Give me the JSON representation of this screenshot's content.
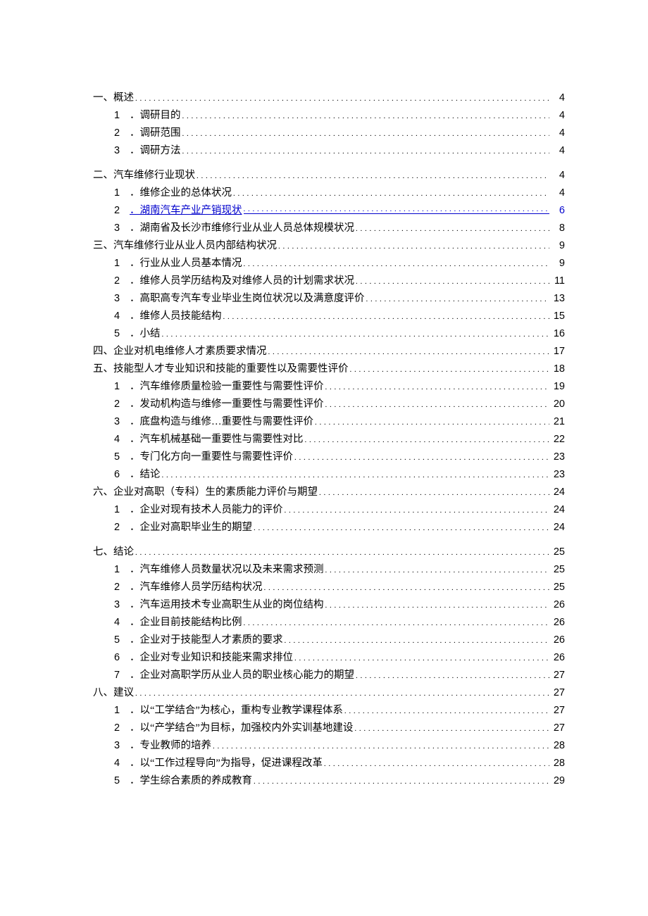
{
  "toc": [
    {
      "level": 1,
      "num": "一、",
      "title": "概述",
      "page": "4",
      "link": false
    },
    {
      "level": 2,
      "num": "1",
      "title": "．调研目的",
      "page": "4",
      "link": false
    },
    {
      "level": 2,
      "num": "2",
      "title": "．调研范围",
      "page": "4",
      "link": false
    },
    {
      "level": 2,
      "num": "3",
      "title": "．调研方法",
      "page": "4",
      "link": false
    },
    {
      "level": 0
    },
    {
      "level": 1,
      "num": "二、",
      "title": "汽车维修行业现状",
      "page": "4",
      "link": false
    },
    {
      "level": 2,
      "num": "1",
      "title": "．维修企业的总体状况",
      "page": "4",
      "link": false
    },
    {
      "level": 2,
      "num": "2",
      "title": "．湖南汽车产业产销现状",
      "page": "6",
      "link": true
    },
    {
      "level": 2,
      "num": "3",
      "title": "．湖南省及长沙市维修行业从业人员总体规模状况",
      "page": "8",
      "link": false
    },
    {
      "level": 1,
      "num": "三、",
      "title": "汽车维修行业从业人员内部结构状况",
      "page": "9",
      "link": false
    },
    {
      "level": 2,
      "num": "1",
      "title": "．行业从业人员基本情况",
      "page": "9",
      "link": false
    },
    {
      "level": 2,
      "num": "2",
      "title": "．维修人员学历结构及对维修人员的计划需求状况",
      "page": "11",
      "link": false
    },
    {
      "level": 2,
      "num": "3",
      "title": "．高职高专汽车专业毕业生岗位状况以及满意度评价",
      "page": "13",
      "link": false
    },
    {
      "level": 2,
      "num": "4",
      "title": "．维修人员技能结构",
      "page": "15",
      "link": false
    },
    {
      "level": 2,
      "num": "5",
      "title": "．小结",
      "page": "16",
      "link": false
    },
    {
      "level": 1,
      "num": "四、",
      "title": "企业对机电维修人才素质要求情况",
      "page": "17",
      "link": false
    },
    {
      "level": 1,
      "num": "五、",
      "title": "技能型人才专业知识和技能的重要性以及需要性评价",
      "page": "18",
      "link": false
    },
    {
      "level": 2,
      "num": "1",
      "title": "．汽车维修质量检验一重要性与需要性评价",
      "page": "19",
      "link": false
    },
    {
      "level": 2,
      "num": "2",
      "title": "．发动机构造与维修一重要性与需要性评价",
      "page": "20",
      "link": false
    },
    {
      "level": 2,
      "num": "3",
      "title": "．底盘构造与维修…重要性与需要性评价",
      "page": "21",
      "link": false
    },
    {
      "level": 2,
      "num": "4",
      "title": "．汽车机械基础一重要性与需要性对比",
      "page": "22",
      "link": false
    },
    {
      "level": 2,
      "num": "5",
      "title": "．专门化方向一重要性与需要性评价",
      "page": "23",
      "link": false
    },
    {
      "level": 2,
      "num": "6",
      "title": "．结论",
      "page": "23",
      "link": false
    },
    {
      "level": 1,
      "num": "六、",
      "title": "企业对高职（专科）生的素质能力评价与期望",
      "page": "24",
      "link": false
    },
    {
      "level": 2,
      "num": "1",
      "title": "．企业对现有技术人员能力的评价",
      "page": "24",
      "link": false
    },
    {
      "level": 2,
      "num": "2",
      "title": "．企业对高职毕业生的期望",
      "page": "24",
      "link": false
    },
    {
      "level": 0
    },
    {
      "level": 1,
      "num": "七、",
      "title": "结论",
      "page": "25",
      "link": false
    },
    {
      "level": 2,
      "num": "1",
      "title": "．汽车维修人员数量状况以及未来需求预测",
      "page": "25",
      "link": false
    },
    {
      "level": 2,
      "num": "2",
      "title": "．汽车维修人员学历结构状况",
      "page": "25",
      "link": false
    },
    {
      "level": 2,
      "num": "3",
      "title": "．汽车运用技术专业高职生从业的岗位结构",
      "page": "26",
      "link": false
    },
    {
      "level": 2,
      "num": "4",
      "title": "．企业目前技能结构比例",
      "page": "26",
      "link": false
    },
    {
      "level": 2,
      "num": "5",
      "title": "．企业对于技能型人才素质的要求",
      "page": "26",
      "link": false
    },
    {
      "level": 2,
      "num": "6",
      "title": "．企业对专业知识和技能来需求排位",
      "page": "26",
      "link": false
    },
    {
      "level": 2,
      "num": "7",
      "title": "．企业对高职学历从业人员的职业核心能力的期望",
      "page": "27",
      "link": false
    },
    {
      "level": 1,
      "num": "八、",
      "title": "建议",
      "page": "27",
      "link": false
    },
    {
      "level": 2,
      "num": "1",
      "title": "．以“工学结合”为核心，重构专业教学课程体系",
      "page": "27",
      "link": false
    },
    {
      "level": 2,
      "num": "2",
      "title": "．以“产学结合”为目标，加强校内外实训基地建设",
      "page": "27",
      "link": false
    },
    {
      "level": 2,
      "num": "3",
      "title": "．专业教师的培养",
      "page": "28",
      "link": false
    },
    {
      "level": 2,
      "num": "4",
      "title": "．以“工作过程导向”为指导，促进课程改革",
      "page": "28",
      "link": false
    },
    {
      "level": 2,
      "num": "5",
      "title": "．学生综合素质的养成教育",
      "page": "29",
      "link": false
    }
  ]
}
